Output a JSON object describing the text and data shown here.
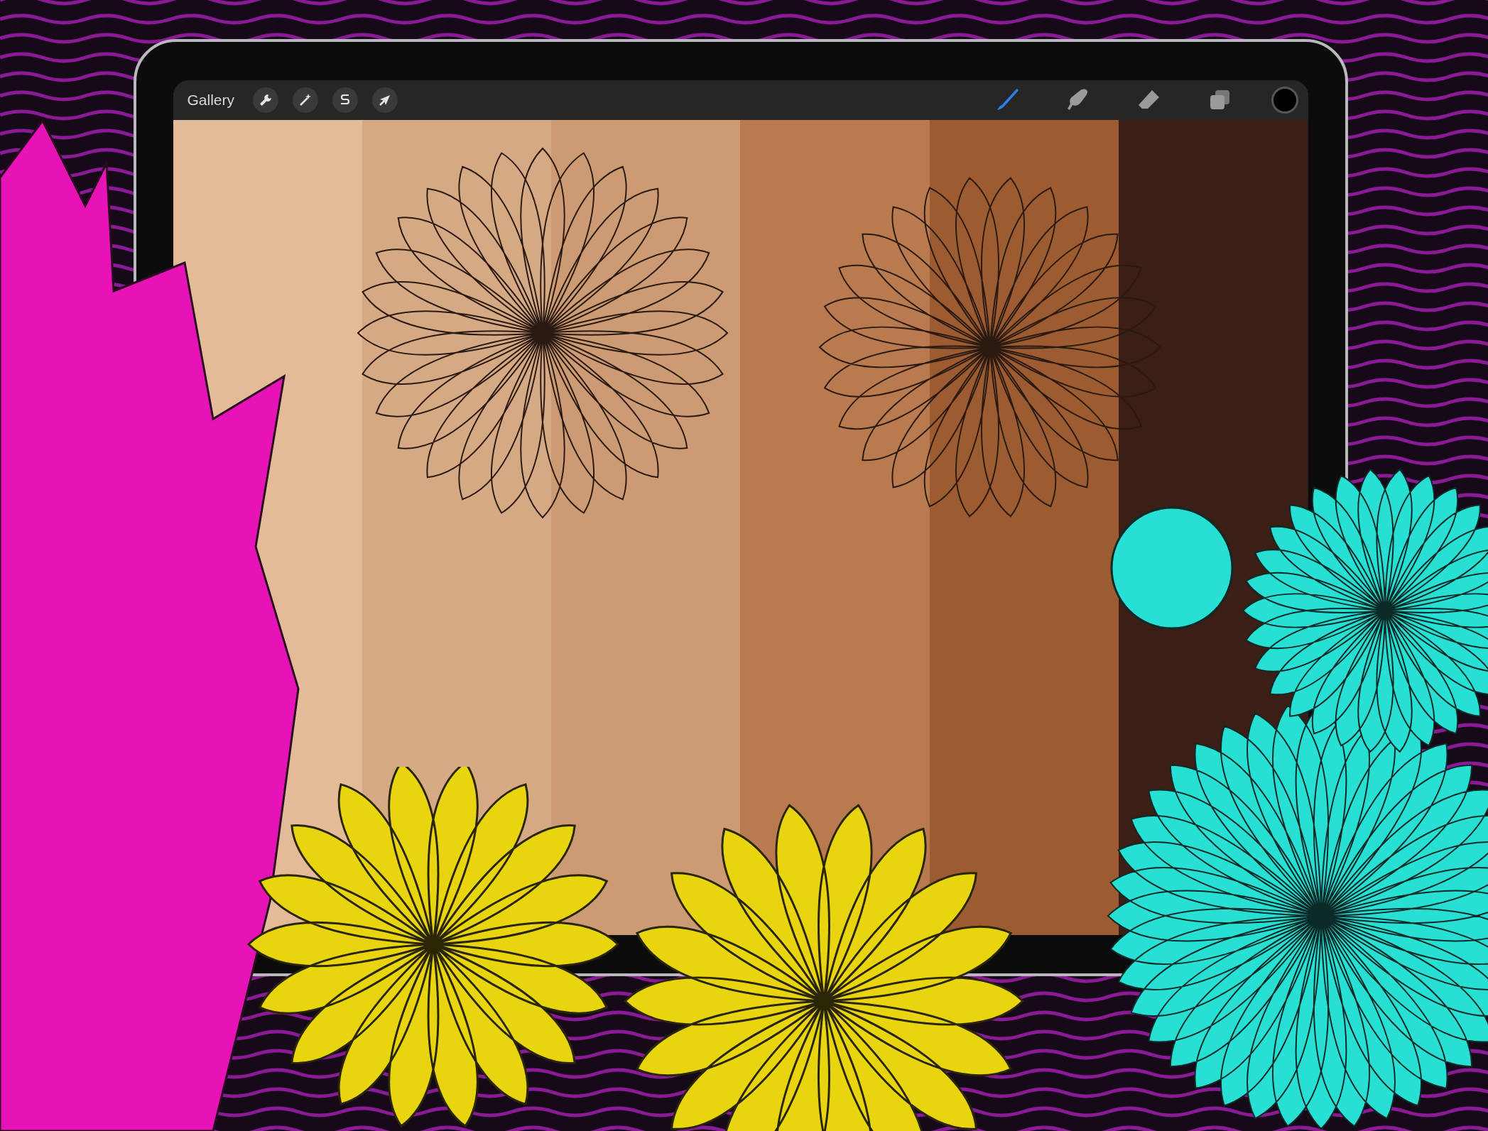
{
  "toolbar": {
    "gallery": "Gallery",
    "left_tools": [
      {
        "kind": "wrench"
      },
      {
        "kind": "wand"
      },
      {
        "kind": "selection"
      },
      {
        "kind": "transform"
      }
    ],
    "right_tools": [
      {
        "kind": "brush",
        "selected": true
      },
      {
        "kind": "smudge",
        "selected": false
      },
      {
        "kind": "eraser",
        "selected": false
      },
      {
        "kind": "layers",
        "selected": false
      }
    ]
  },
  "canvas": {
    "stripes": [
      {
        "color": "#e3bb99"
      },
      {
        "color": "#d6a985"
      },
      {
        "color": "#cc9b74"
      },
      {
        "color": "#b97a4f"
      },
      {
        "color": "#9c5b30"
      },
      {
        "color": "#3b1f17"
      }
    ]
  }
}
